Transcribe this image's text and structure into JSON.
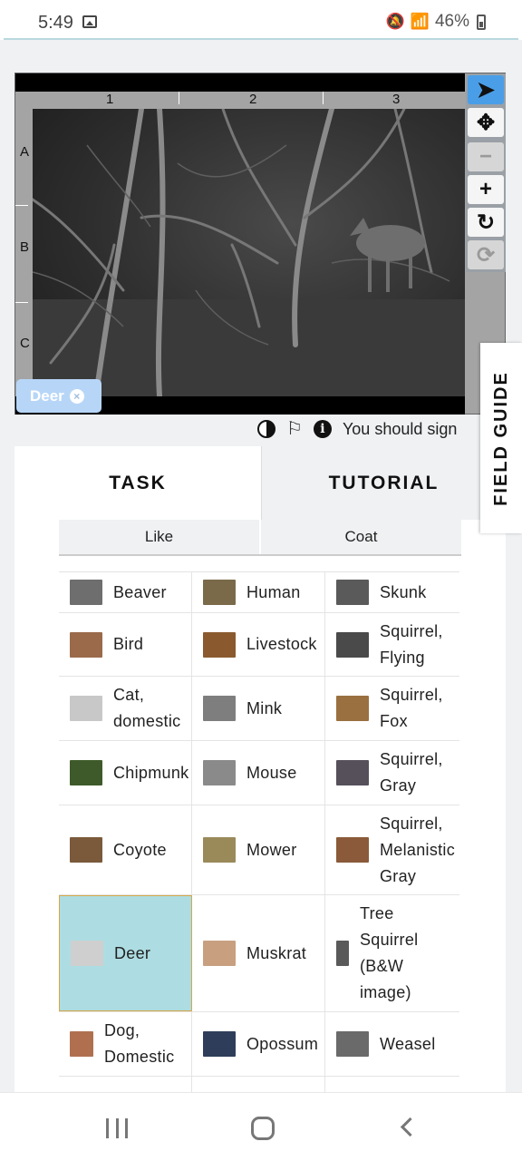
{
  "status_bar": {
    "time": "5:49",
    "battery": "46%"
  },
  "viewer": {
    "columns": [
      "1",
      "2",
      "3"
    ],
    "rows": [
      "A",
      "B",
      "C"
    ],
    "tag": {
      "label": "Deer",
      "remove": "×"
    },
    "tools": [
      "pointer",
      "move",
      "zoom-out",
      "zoom-in",
      "rotate",
      "reset"
    ]
  },
  "info_row": {
    "message": "You should sign"
  },
  "tabs": {
    "task": "TASK",
    "tutorial": "TUTORIAL"
  },
  "filters": [
    "Like",
    "Coat"
  ],
  "species_rows": [
    [
      {
        "label": "Beaver",
        "thumb": "#6e6e6e"
      },
      {
        "label": "Human",
        "thumb": "#7a6a4a"
      },
      {
        "label": "Skunk",
        "thumb": "#5a5a5a"
      }
    ],
    [
      {
        "label": "Bird",
        "thumb": "#9a6a4a"
      },
      {
        "label": "Livestock",
        "thumb": "#8a5a2e"
      },
      {
        "label": "Squirrel,\nFlying",
        "thumb": "#4a4a4a"
      }
    ],
    [
      {
        "label": "Cat,\ndomestic",
        "thumb": "#c8c8c8"
      },
      {
        "label": "Mink",
        "thumb": "#7e7e7e"
      },
      {
        "label": "Squirrel,\nFox",
        "thumb": "#9a7040"
      }
    ],
    [
      {
        "label": "Chipmunk",
        "thumb": "#3e5a2a"
      },
      {
        "label": "Mouse",
        "thumb": "#8a8a8a"
      },
      {
        "label": "Squirrel,\nGray",
        "thumb": "#55505a"
      }
    ],
    [
      {
        "label": "Coyote",
        "thumb": "#7a5a3a"
      },
      {
        "label": "Mower",
        "thumb": "#9a8a5a"
      },
      {
        "label": "Squirrel,\nMelanistic\nGray",
        "thumb": "#8a5a3a"
      }
    ],
    [
      {
        "label": "Deer",
        "thumb": "#cfcfcf",
        "selected": true
      },
      {
        "label": "Muskrat",
        "thumb": "#c8a080"
      },
      {
        "label": "Tree\nSquirrel\n(B&W\nimage)",
        "thumb": "#5a5a5a"
      }
    ],
    [
      {
        "label": "Dog,\nDomestic",
        "thumb": "#b07050"
      },
      {
        "label": "Opossum",
        "thumb": "#2e3e5a"
      },
      {
        "label": "Weasel",
        "thumb": "#6a6a6a"
      }
    ]
  ],
  "field_guide": "FIELD GUIDE"
}
